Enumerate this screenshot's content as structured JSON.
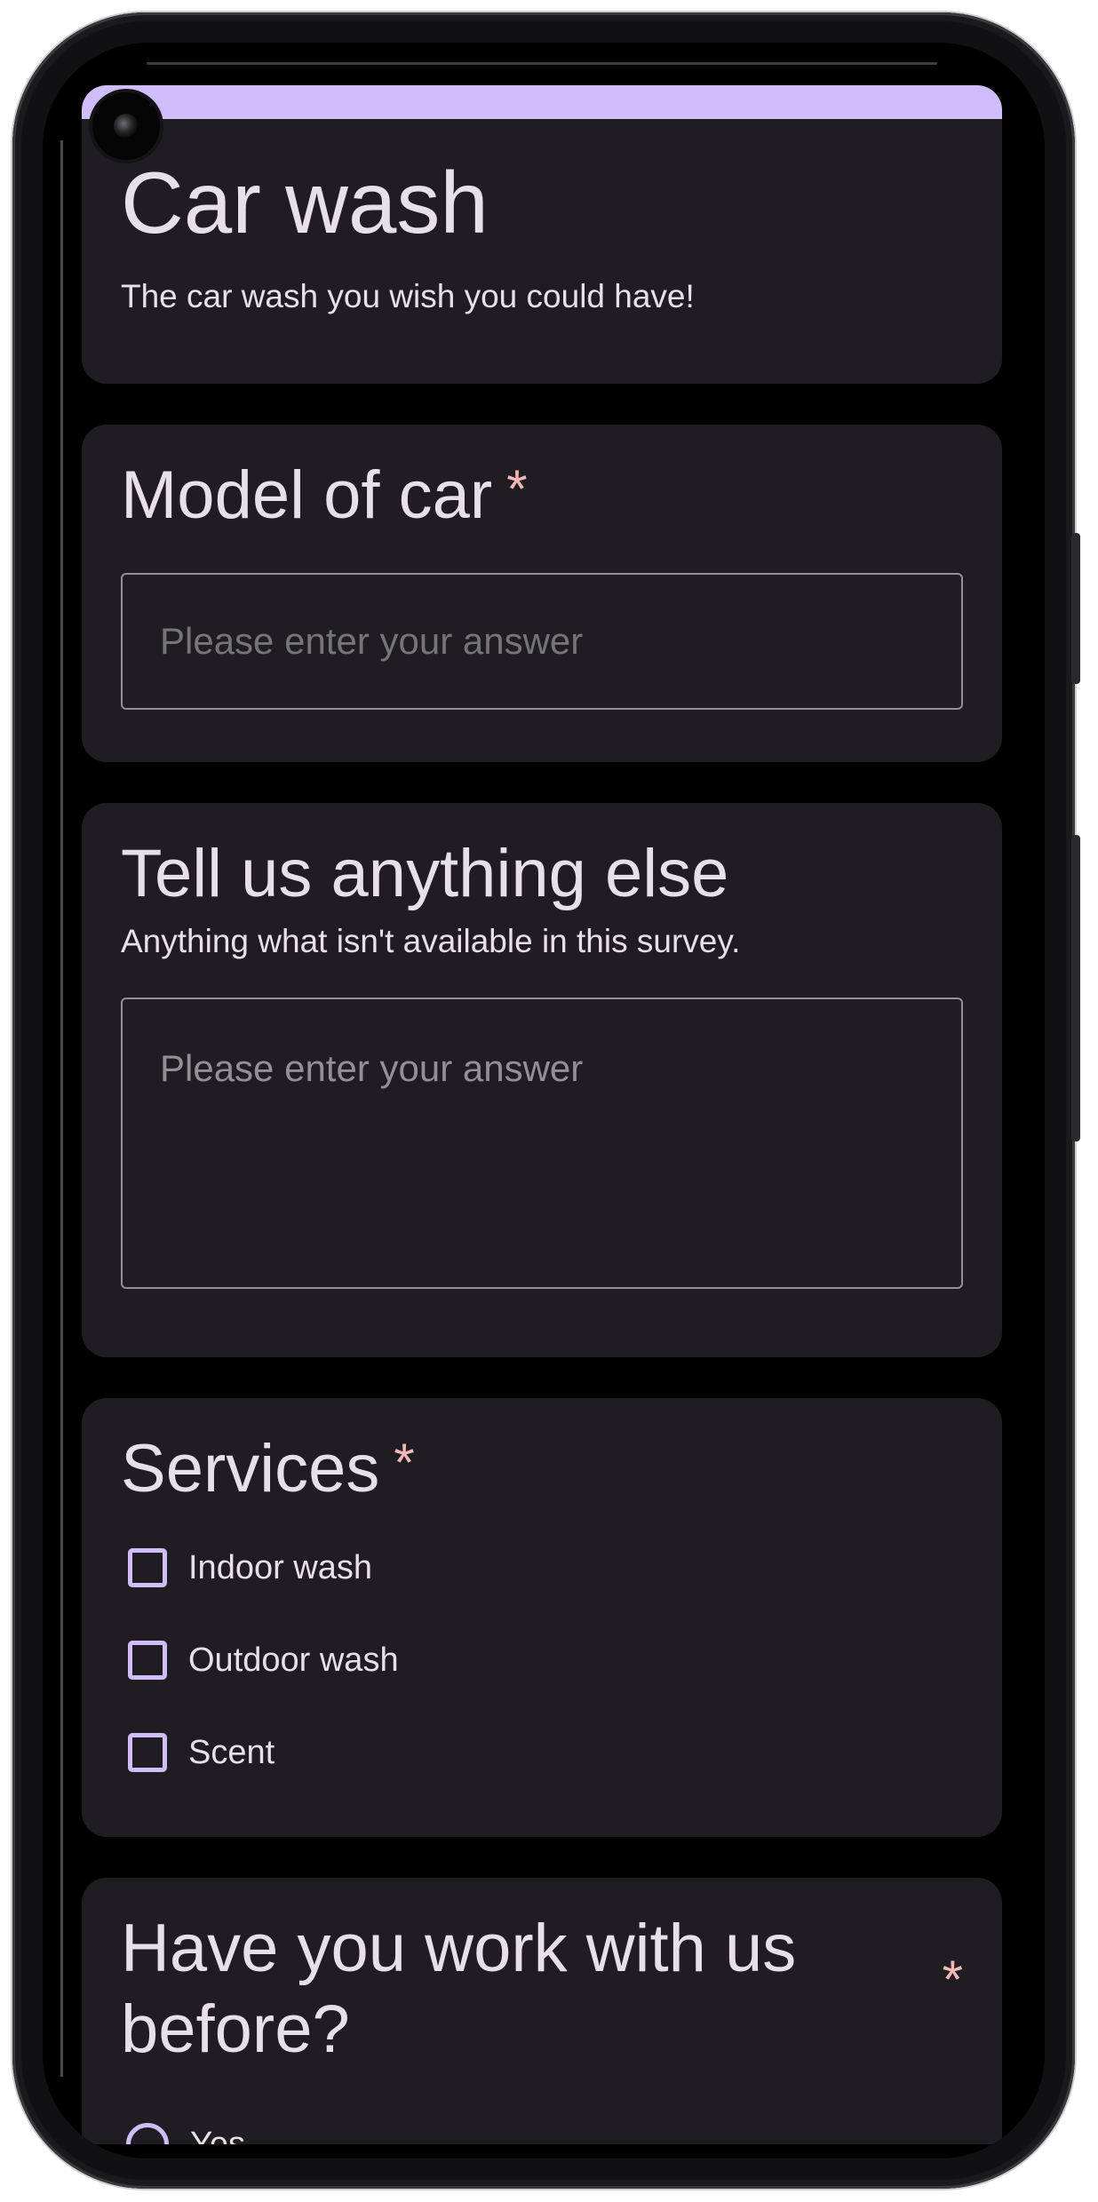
{
  "form": {
    "title": "Car wash",
    "description": "The car wash you wish you could have!",
    "accent_color": "#d1bcfa",
    "required_color": "#f2b8b5"
  },
  "questions": {
    "model": {
      "title": "Model of car",
      "required": "*",
      "placeholder": "Please enter your answer"
    },
    "anything_else": {
      "title": "Tell us anything else",
      "description": "Anything what isn't available in this survey.",
      "placeholder": "Please enter your answer"
    },
    "services": {
      "title": "Services",
      "required": "*",
      "options": [
        "Indoor wash",
        "Outdoor wash",
        "Scent"
      ]
    },
    "worked_before": {
      "title": "Have you work with us before?",
      "required": "*",
      "options": [
        "Yes"
      ]
    }
  },
  "icons": {
    "camera": "front-camera-icon",
    "checkbox": "checkbox-unchecked-icon",
    "radio": "radio-unchecked-icon"
  }
}
